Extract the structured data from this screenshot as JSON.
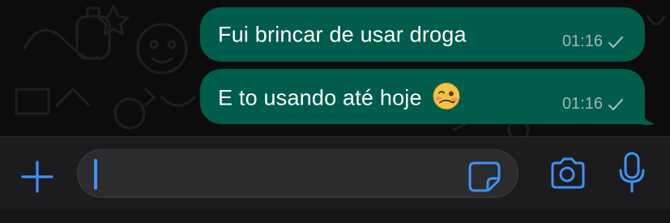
{
  "messages": [
    {
      "text": "Fui brincar de usar droga",
      "time": "01:16",
      "status_icon": "sent-check-icon"
    },
    {
      "text": "E to usando até hoje",
      "emoji": "woozy-face-icon",
      "time": "01:16",
      "status_icon": "sent-check-icon"
    }
  ],
  "composer": {
    "value": "",
    "placeholder": "",
    "buttons": {
      "attach": "plus-icon",
      "sticker": "sticker-icon",
      "camera": "camera-icon",
      "mic": "microphone-icon"
    }
  },
  "colors": {
    "outgoing_bubble": "#005c4b",
    "accent_blue": "#3e92f5",
    "background": "#0b0b0b",
    "input_bar": "#1c1c1e"
  }
}
